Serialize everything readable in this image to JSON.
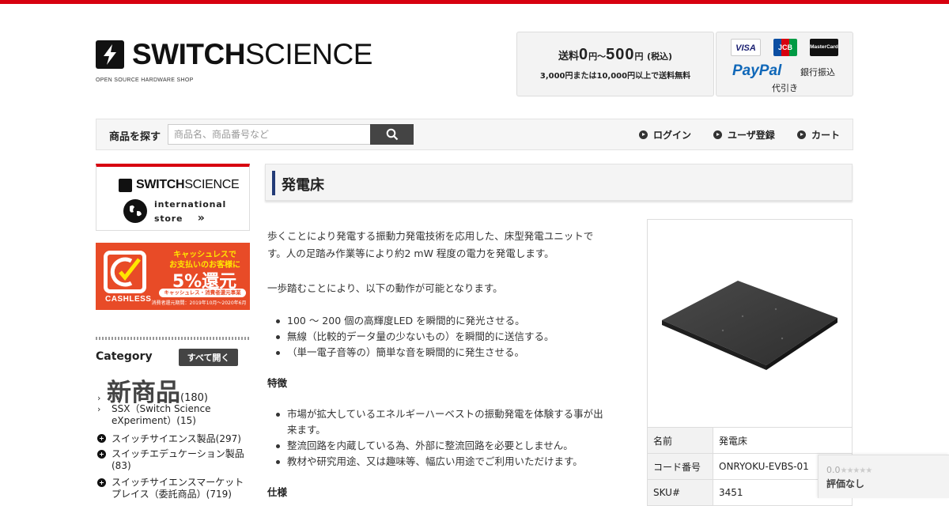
{
  "header": {
    "logo_bold": "SWITCH",
    "logo_light": "SCIENCE",
    "logo_sub": "OPEN SOURCE HARDWARE SHOP",
    "shipping": {
      "prefix": "送料",
      "v1": "0",
      "yen1": "円～",
      "v2": "500",
      "yen2": "円",
      "tax": "(税込)",
      "line2": "3,000円または10,000円以上で送料無料"
    },
    "payment": {
      "visa": "VISA",
      "jcb": "JCB",
      "mastercard": "MasterCard",
      "paypal": "PayPal",
      "bank": "銀行振込",
      "cod": "代引き"
    }
  },
  "nav": {
    "label": "商品を探す",
    "search_placeholder": "商品名、商品番号など",
    "login": "ログイン",
    "register": "ユーザ登録",
    "cart": "カート"
  },
  "sidebar": {
    "intl_logo_bold": "SWITCH",
    "intl_logo_light": "SCIENCE",
    "intl_line1": "international",
    "intl_line2": "store",
    "intl_arrow": "»",
    "cashless": {
      "line1": "キャッシュレスで",
      "line2": "お支払いのお客様に",
      "big": "5%還元",
      "pill": "キャッシュレス・消費者還元事業",
      "note": "消費者還元期間：2019年10月〜2020年6月",
      "word": "CASHLESS"
    },
    "category_title": "Category",
    "expand_all": "すべて開く",
    "categories": [
      {
        "label": "新商品",
        "count": "(180)"
      },
      {
        "label": "SSX（Switch Science eXperiment）",
        "label_l1": "SSX（Switch Science",
        "label_l2": "eXperiment）",
        "count": "(15)"
      },
      {
        "label": "スイッチサイエンス製品",
        "count": "(297)"
      },
      {
        "label": "スイッチエデュケーション製品",
        "count": "(83)"
      },
      {
        "label": "スイッチサイエンスマーケットプレイス（委託商品）",
        "label_l1": "スイッチサイエンスマーケット",
        "label_l2": "プレイス（委託商品）",
        "count": "(719)"
      }
    ]
  },
  "product": {
    "title": "発電床",
    "desc1_l1": "歩くことにより発電する振動力発電技術を応用した、床型発電ユニットで",
    "desc1_l2": "す。人の足踏み作業等により約2 mW 程度の電力を発電します。",
    "desc2": "一歩踏むことにより、以下の動作が可能となります。",
    "bullets1": [
      "100 ～ 200 個の高輝度LED を瞬間的に発光させる。",
      "無線（比較的データ量の少ないもの）を瞬間的に送信する。",
      "（単一電子音等の）簡単な音を瞬間的に発生させる。"
    ],
    "features_heading": "特徴",
    "bullets2": [
      {
        "l1": "市場が拡大しているエネルギーハーベストの振動発電を体験する事が出",
        "l2": "来ます。"
      },
      {
        "l1": "整流回路を内蔵している為、外部に整流回路を必要としません。"
      },
      {
        "l1": "教材や研究用途、又は趣味等、幅広い用途でご利用いただけます。"
      }
    ],
    "spec_heading": "仕様",
    "specs": [
      {
        "key": "名前",
        "value": "発電床"
      },
      {
        "key": "コード番号",
        "value": "ONRYOKU-EVBS-01"
      },
      {
        "key": "SKU#",
        "value": "3451"
      }
    ]
  },
  "rating": {
    "score": "0.0",
    "stars": "★★★★★",
    "label": "評価なし"
  }
}
